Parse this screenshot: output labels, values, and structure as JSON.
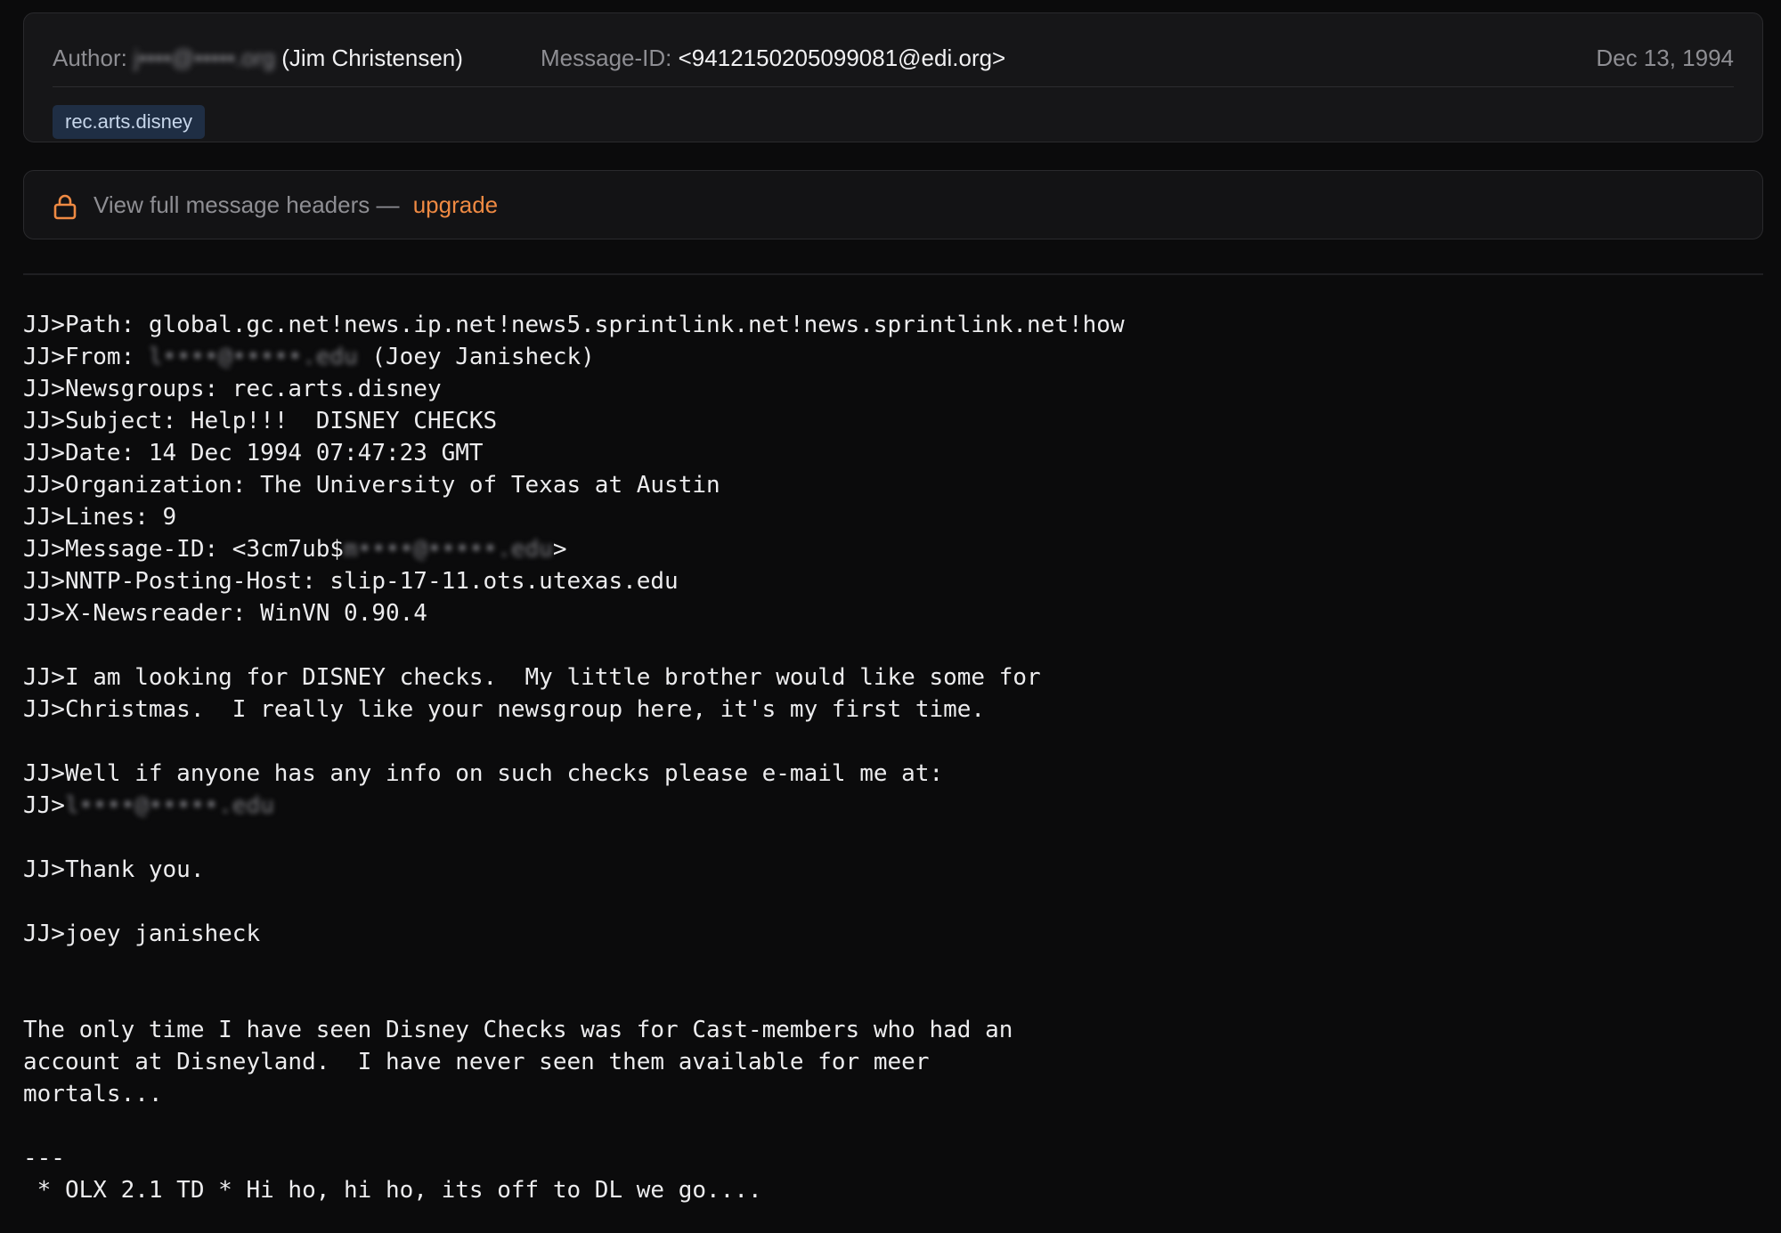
{
  "meta": {
    "author_label": "Author:",
    "author_email_redacted": "j••••@•••••.org",
    "author_name": "(Jim Christensen)",
    "msgid_label": "Message-ID:",
    "msgid_value": "<9412150205099081@edi.org>",
    "date": "Dec 13, 1994",
    "newsgroup_tag": "rec.arts.disney"
  },
  "headers_notice": {
    "icon": "lock-icon",
    "text": "View full message headers —",
    "upgrade_label": "upgrade",
    "accent_color": "#ef8a43"
  },
  "body": {
    "path": "JJ>Path: global.gc.net!news.ip.net!news5.sprintlink.net!news.sprintlink.net!how",
    "from_prefix": "JJ>From: ",
    "from_email_redacted": "l••••@•••••.edu",
    "from_suffix": " (Joey Janisheck)",
    "newsgroups": "JJ>Newsgroups: rec.arts.disney",
    "subject": "JJ>Subject: Help!!!  DISNEY CHECKS",
    "date": "JJ>Date: 14 Dec 1994 07:47:23 GMT",
    "organization": "JJ>Organization: The University of Texas at Austin",
    "lines": "JJ>Lines: 9",
    "msgid_prefix": "JJ>Message-ID: <3cm7ub$",
    "msgid_redacted": "m••••@•••••.edu",
    "msgid_suffix": ">",
    "nntp_host": "JJ>NNTP-Posting-Host: slip-17-11.ots.utexas.edu",
    "newsreader": "JJ>X-Newsreader: WinVN 0.90.4",
    "quote_1": "JJ>I am looking for DISNEY checks.  My little brother would like some for",
    "quote_2": "JJ>Christmas.  I really like your newsgroup here, it's my first time.",
    "quote_3": "JJ>Well if anyone has any info on such checks please e-mail me at:",
    "quote_4_prefix": "JJ>",
    "quote_4_redacted": "l••••@•••••.edu",
    "quote_5": "JJ>Thank you.",
    "quote_6": "JJ>joey janisheck",
    "reply_1": "The only time I have seen Disney Checks was for Cast-members who had an",
    "reply_2": "account at Disneyland.  I have never seen them available for meer",
    "reply_3": "mortals...",
    "sig_rule": "---",
    "sig_line": " * OLX 2.1 TD * Hi ho, hi ho, its off to DL we go...."
  }
}
